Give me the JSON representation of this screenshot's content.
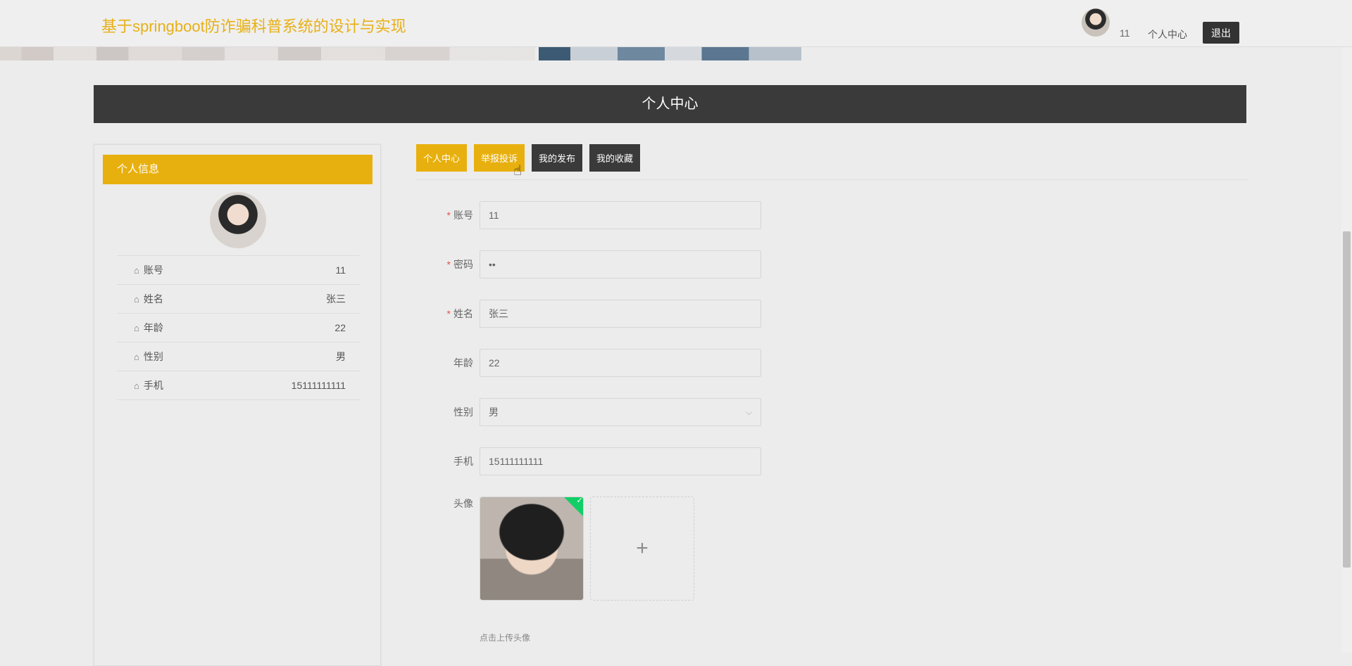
{
  "header": {
    "title": "基于springboot防诈骗科普系统的设计与实现",
    "username": "11",
    "center_link": "个人中心",
    "logout": "退出"
  },
  "page_title": "个人中心",
  "left_panel": {
    "heading": "个人信息",
    "items": [
      {
        "label": "账号",
        "value": "11"
      },
      {
        "label": "姓名",
        "value": "张三"
      },
      {
        "label": "年龄",
        "value": "22"
      },
      {
        "label": "性别",
        "value": "男"
      },
      {
        "label": "手机",
        "value": "15111111111"
      }
    ]
  },
  "tabs": [
    {
      "label": "个人中心",
      "state": "active"
    },
    {
      "label": "举报投诉",
      "state": "hover"
    },
    {
      "label": "我的发布",
      "state": "default"
    },
    {
      "label": "我的收藏",
      "state": "default"
    }
  ],
  "form": {
    "account": {
      "label": "账号",
      "value": "11",
      "required": true
    },
    "password": {
      "label": "密码",
      "value": "••",
      "required": true
    },
    "name": {
      "label": "姓名",
      "value": "张三",
      "required": true
    },
    "age": {
      "label": "年龄",
      "value": "22"
    },
    "gender": {
      "label": "性别",
      "value": "男"
    },
    "phone": {
      "label": "手机",
      "value": "15111111111"
    },
    "avatar": {
      "label": "头像",
      "tip": "点击上传头像"
    }
  },
  "colors": {
    "accent": "#e8b00e",
    "dark": "#3a3a3a",
    "success": "#13ce66"
  }
}
